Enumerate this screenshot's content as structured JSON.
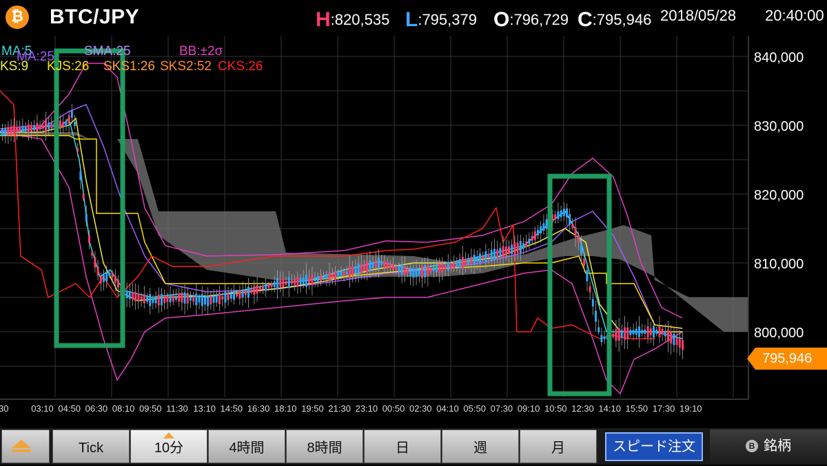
{
  "header": {
    "pair": "BTC/JPY",
    "h_key": "H",
    "h_value": ":820,535",
    "l_key": "L",
    "l_value": ":795,379",
    "o_key": "O",
    "o_value": ":796,729",
    "c_key": "C",
    "c_value": ":795,946",
    "date": "2018/05/28",
    "time": "20:40:00",
    "colors": {
      "h": "#ff3d6e",
      "l": "#44a6ff",
      "o": "#ffffff",
      "c": "#ffffff"
    }
  },
  "legend": {
    "row1": [
      {
        "label": "MA:5",
        "color": "#44d6e0"
      },
      {
        "label": "MA:25",
        "color": "#a05cff"
      },
      {
        "label": "SMA:25",
        "color": "#b58cff"
      },
      {
        "label": "BB:±2σ",
        "color": "#e040c0"
      }
    ],
    "row2": [
      {
        "label": "KS:9",
        "color": "#f0f040"
      },
      {
        "label": "KJS:26",
        "color": "#ffe000"
      },
      {
        "label": "SKS1:26",
        "color": "#ffa030"
      },
      {
        "label": "SKS2:52",
        "color": "#ff8a30"
      },
      {
        "label": "CKS:26",
        "color": "#ff2020"
      }
    ]
  },
  "axis": {
    "y_ticks": [
      "840,000",
      "830,000",
      "820,000",
      "810,000",
      "800,000"
    ],
    "x_ticks": [
      "30",
      "03:10",
      "04:50",
      "06:30",
      "08:10",
      "09:50",
      "11:30",
      "13:10",
      "14:50",
      "16:30",
      "18:10",
      "19:50",
      "21:30",
      "23:10",
      "00:50",
      "02:30",
      "04:10",
      "05:50",
      "07:30",
      "09:10",
      "10:50",
      "12:30",
      "14:10",
      "15:50",
      "17:30",
      "19:10"
    ]
  },
  "price_tag": "795,946",
  "footer": {
    "tabs": [
      "Tick",
      "10分",
      "4時間",
      "8時間",
      "日",
      "週",
      "月"
    ],
    "active_tab": "10分",
    "speed_order": "スピード注文",
    "meigara": "銘柄"
  },
  "highlight_color": "#1f9a60",
  "icons": [
    "btc-logo-icon",
    "menu-up-icon",
    "bitcoin-small-icon"
  ]
}
